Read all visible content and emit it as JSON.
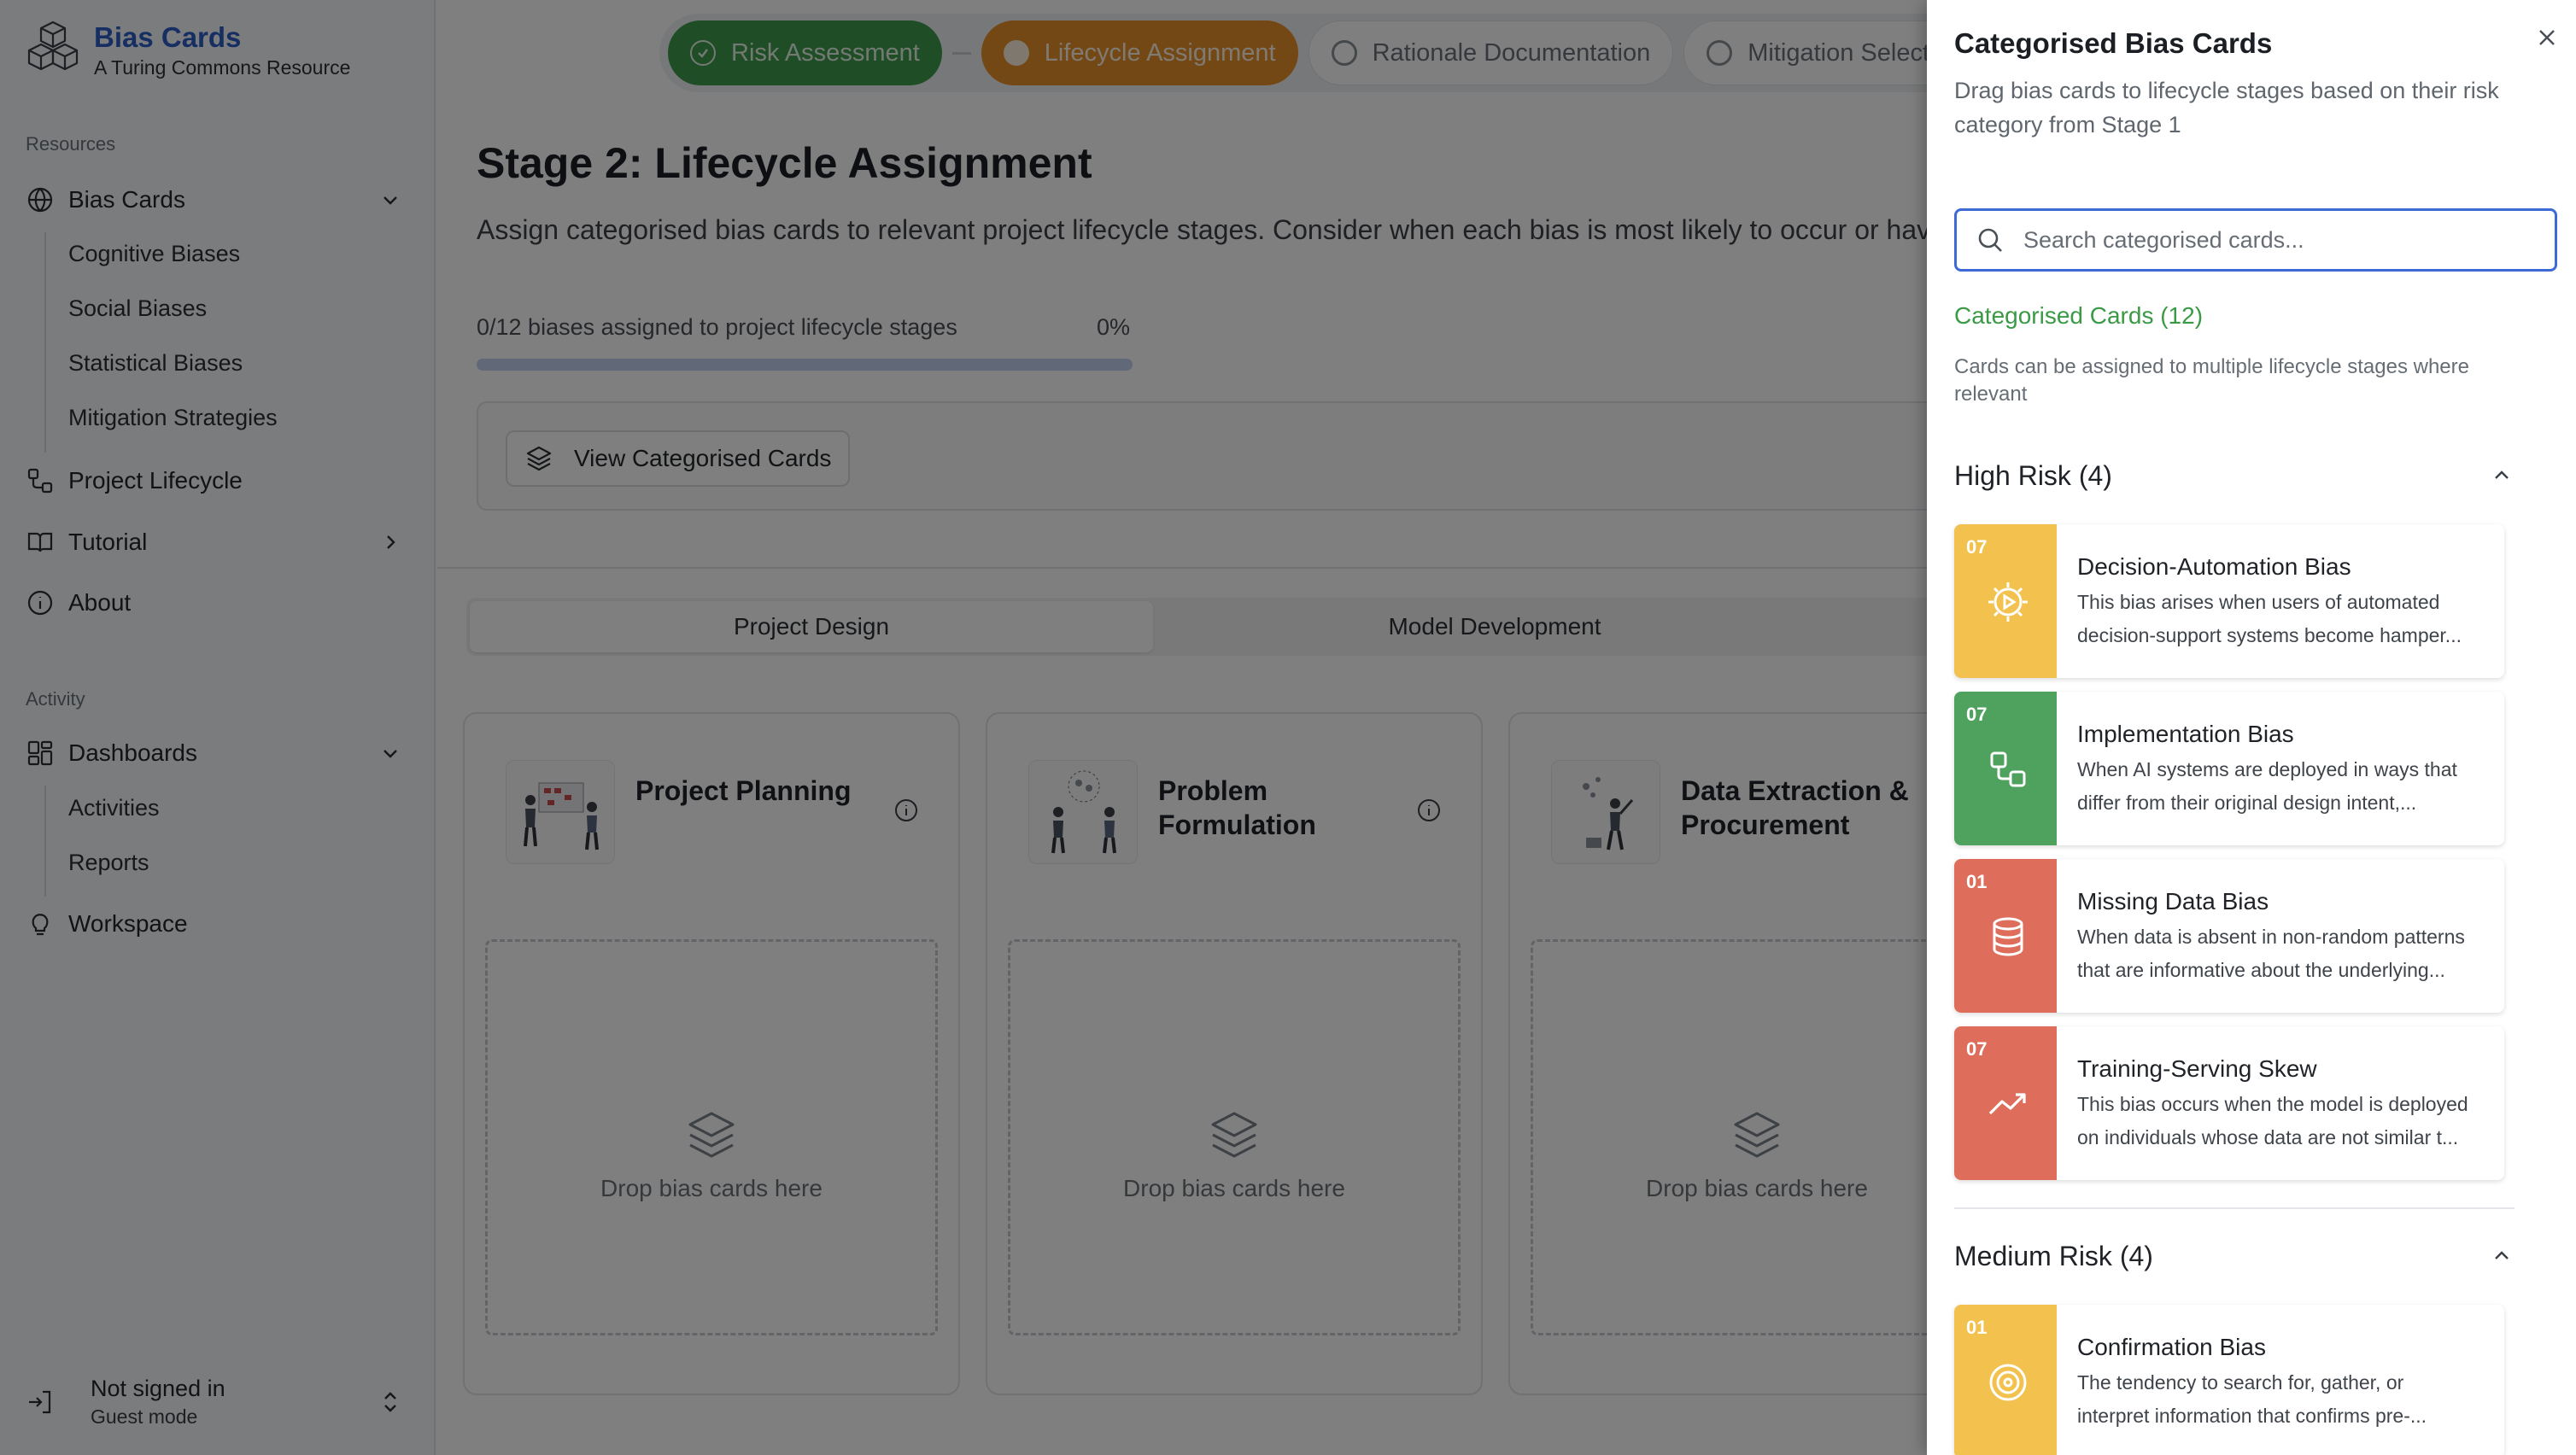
{
  "brand": {
    "title": "Bias Cards",
    "subtitle": "A Turing Commons Resource"
  },
  "sidebar": {
    "resources_label": "Resources",
    "bias_cards": "Bias Cards",
    "bias_sub": [
      "Cognitive Biases",
      "Social Biases",
      "Statistical Biases",
      "Mitigation Strategies"
    ],
    "project_lifecycle": "Project Lifecycle",
    "tutorial": "Tutorial",
    "about": "About",
    "activity_label": "Activity",
    "dashboards": "Dashboards",
    "dash_sub": [
      "Activities",
      "Reports"
    ],
    "workspace": "Workspace",
    "user": {
      "status": "Not signed in",
      "mode": "Guest mode"
    }
  },
  "stepper": [
    "Risk Assessment",
    "Lifecycle Assignment",
    "Rationale Documentation",
    "Mitigation Selectio"
  ],
  "stage": {
    "title": "Stage 2: Lifecycle Assignment",
    "description": "Assign categorised bias cards to relevant project lifecycle stages. Consider when each bias is most likely to occur or have impact.",
    "progress_label": "0/12 biases assigned to project lifecycle stages",
    "progress_pct": "0%",
    "progress_value": 0,
    "view_button": "View Categorised Cards",
    "tabs": [
      "Project Design",
      "Model Development"
    ]
  },
  "lifecycle_cards": [
    {
      "name": "Project Planning",
      "drop": "Drop bias cards here"
    },
    {
      "name": "Problem Formulation",
      "drop": "Drop bias cards here"
    },
    {
      "name": "Data Extraction & Procurement",
      "drop": "Drop bias cards here"
    }
  ],
  "sheet": {
    "title": "Categorised Bias Cards",
    "description": "Drag bias cards to lifecycle stages based on their risk category from Stage 1",
    "search_placeholder": "Search categorised cards...",
    "count_label": "Categorised Cards (12)",
    "note": "Cards can be assigned to multiple lifecycle stages where relevant",
    "high_risk_label": "High Risk (4)",
    "medium_risk_label": "Medium Risk (4)",
    "cards": [
      {
        "num": "07",
        "name": "Decision-Automation Bias",
        "desc1": "This bias arises when users of automated",
        "desc2": "decision-support systems become hamper...",
        "color": "#f2c14e",
        "icon": "gear-play-icon"
      },
      {
        "num": "07",
        "name": "Implementation Bias",
        "desc1": "When AI systems are deployed in ways that",
        "desc2": "differ from their original design intent,...",
        "color": "#4fa25e",
        "icon": "workflow-icon"
      },
      {
        "num": "01",
        "name": "Missing Data Bias",
        "desc1": "When data is absent in non-random patterns",
        "desc2": "that are informative about the underlying...",
        "color": "#de6e5b",
        "icon": "database-icon"
      },
      {
        "num": "07",
        "name": "Training-Serving Skew",
        "desc1": "This bias occurs when the model is deployed",
        "desc2": "on individuals whose data are not similar t...",
        "color": "#de6e5b",
        "icon": "trend-up-icon"
      },
      {
        "num": "01",
        "name": "Confirmation Bias",
        "desc1": "The tendency to search for, gather, or",
        "desc2": "interpret information that confirms pre-...",
        "color": "#f2c14e",
        "icon": "target-icon"
      }
    ]
  },
  "colors": {
    "accent": "#2c5cc5",
    "done": "#3e9a4a",
    "active": "#e8912a",
    "progress": "#3366cc"
  }
}
